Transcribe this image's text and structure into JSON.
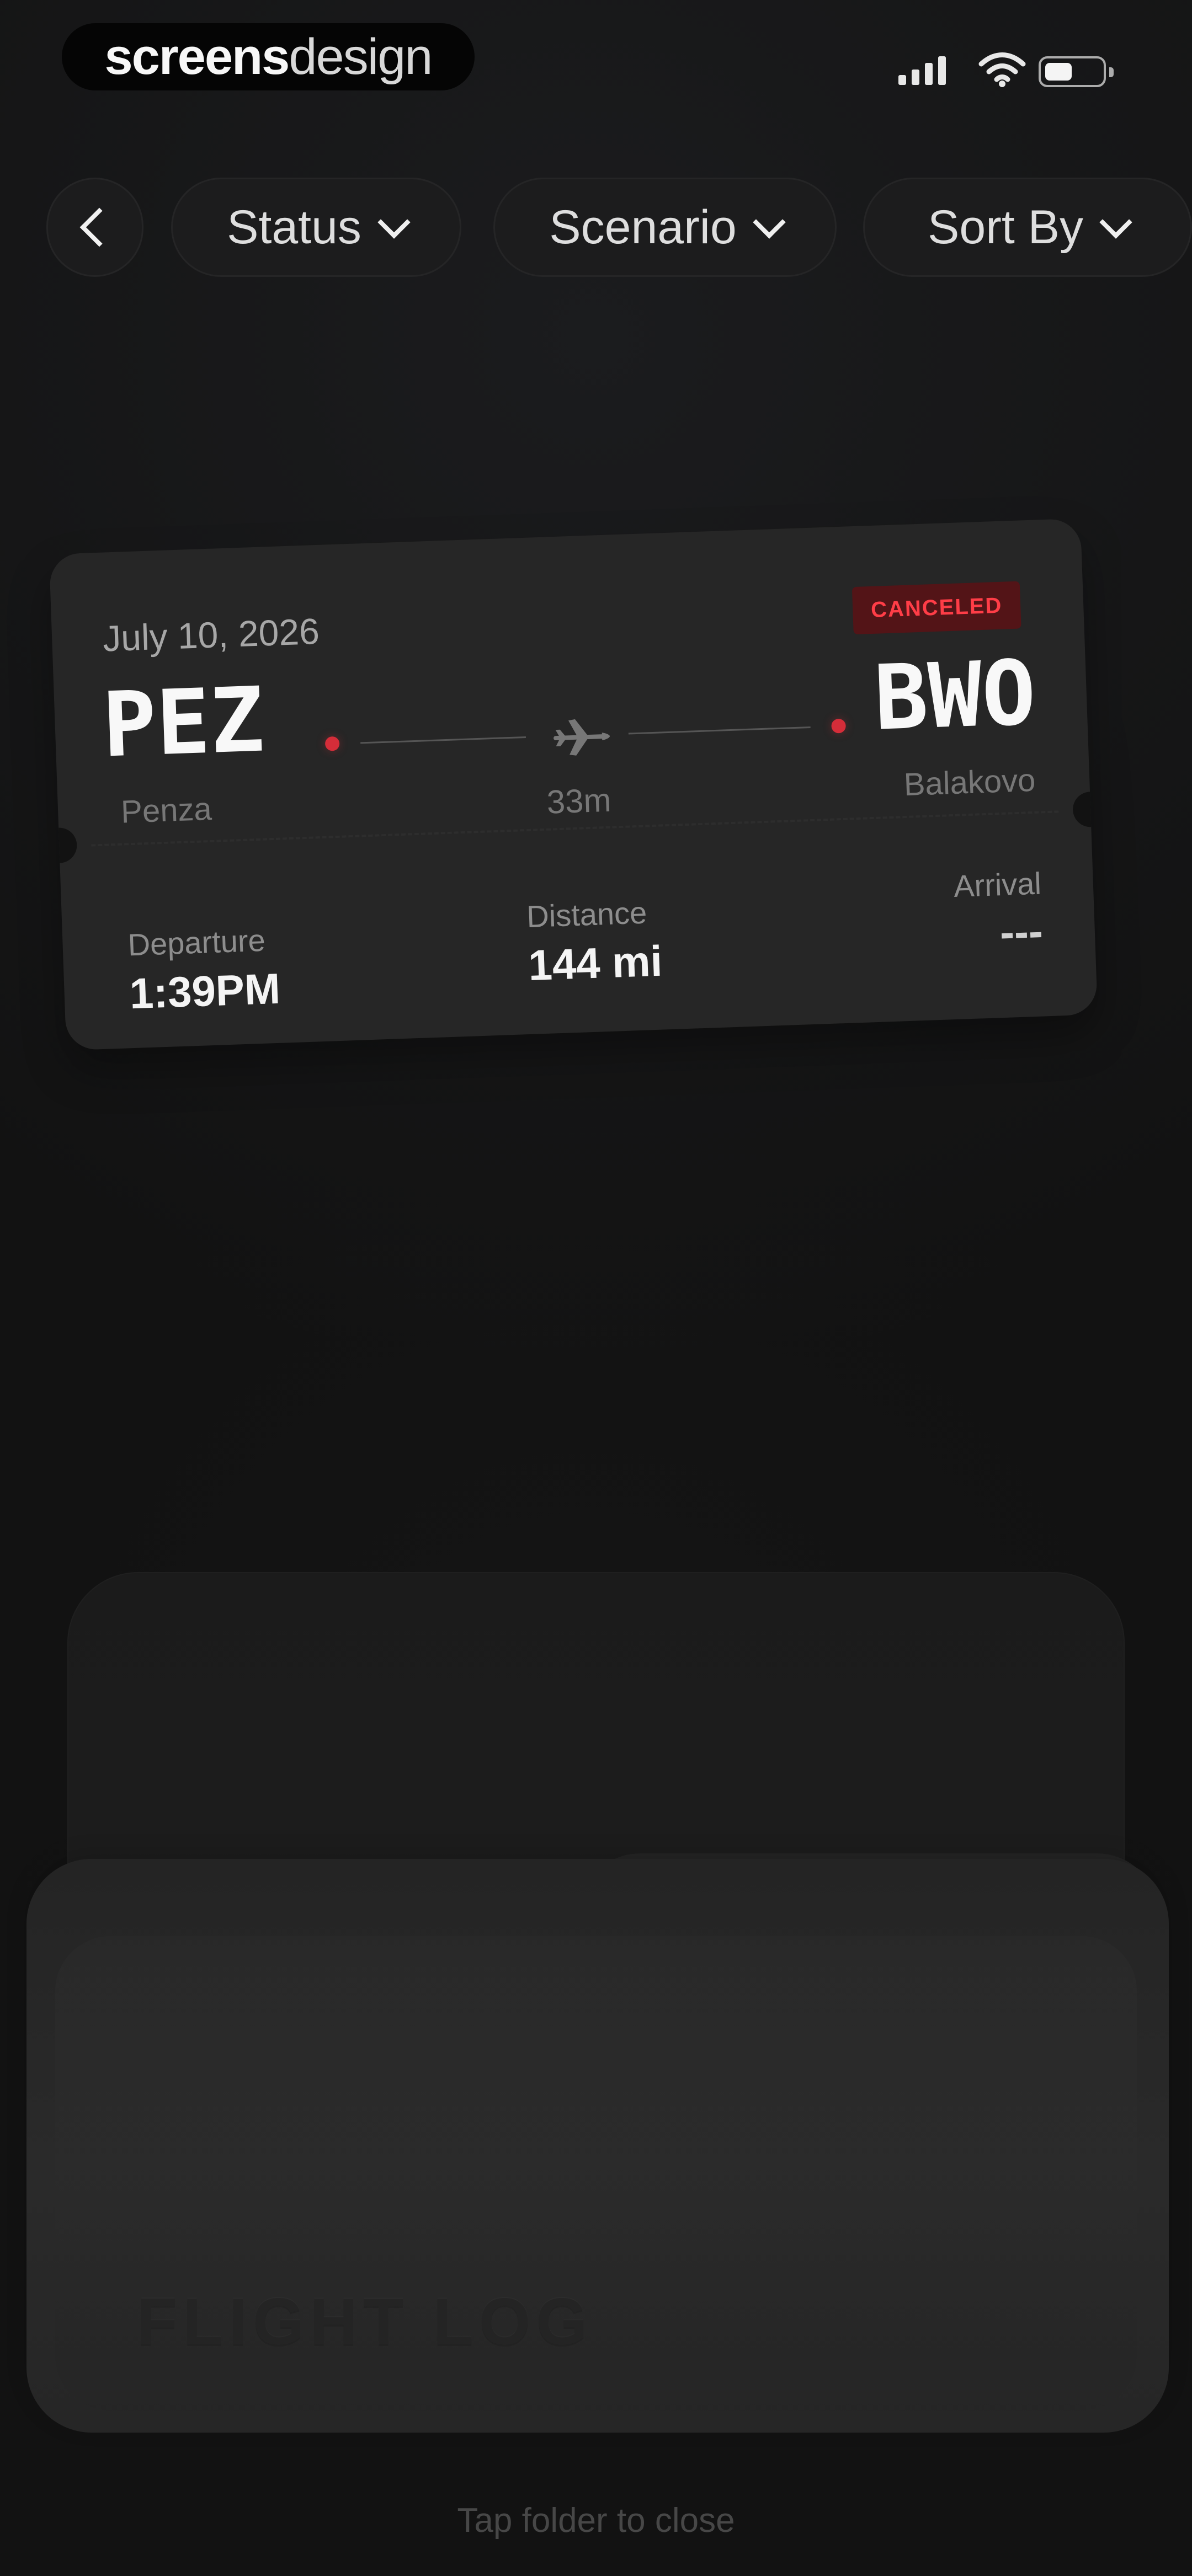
{
  "brand": {
    "name_strong": "screens",
    "name_light": "design"
  },
  "status_bar": {
    "icons": [
      "signal-icon",
      "wifi-icon",
      "battery-icon"
    ]
  },
  "filters": {
    "back_icon": "chevron-left-icon",
    "items": [
      {
        "label": "Status",
        "icon": "chevron-down-icon"
      },
      {
        "label": "Scenario",
        "icon": "chevron-down-icon"
      },
      {
        "label": "Sort By",
        "icon": "chevron-down-icon"
      }
    ]
  },
  "ticket": {
    "date": "July 10, 2026",
    "status": "CANCELED",
    "origin": {
      "code": "PEZ",
      "city": "Penza"
    },
    "destination": {
      "code": "BWO",
      "city": "Balakovo"
    },
    "duration": "33m",
    "departure_label": "Departure",
    "departure_value": "1:39PM",
    "distance_label": "Distance",
    "distance_value": "144 mi",
    "arrival_label": "Arrival",
    "arrival_value": "---",
    "icon": "plane-icon"
  },
  "folder": {
    "label": "FLIGHT LOG"
  },
  "hint": {
    "text": "Tap folder to close"
  },
  "colors": {
    "background": "#121212",
    "card": "#262626",
    "status_red": "#ff3d47",
    "route_red": "#d52d39",
    "folder": "#242424"
  }
}
